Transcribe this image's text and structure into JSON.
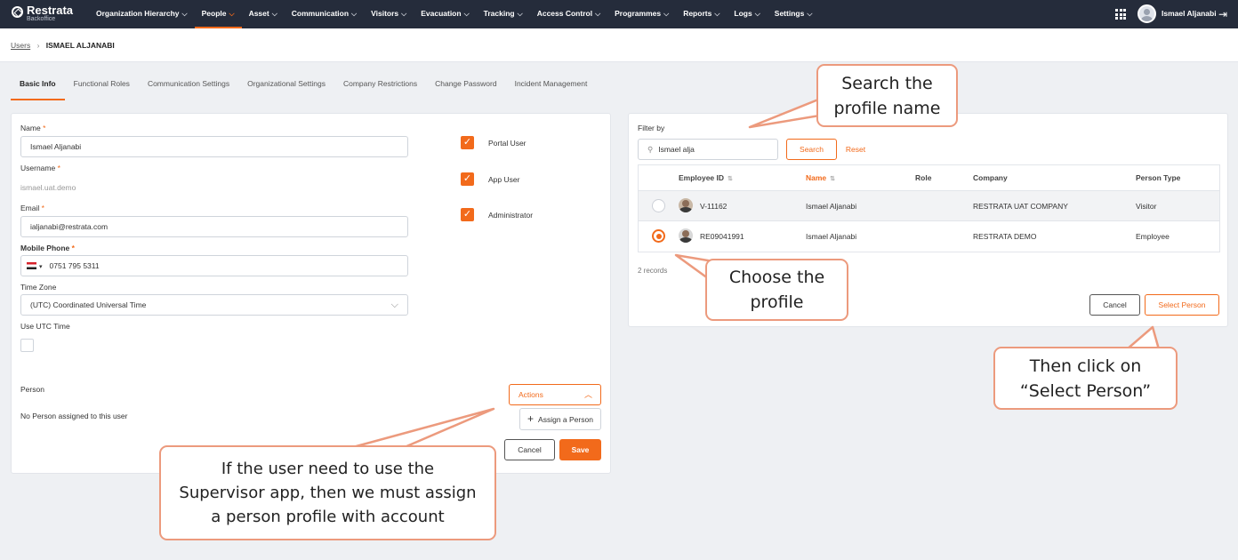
{
  "app": {
    "name": "Restrata",
    "sub": "Backoffice"
  },
  "nav": [
    {
      "label": "Organization Hierarchy",
      "active": false
    },
    {
      "label": "People",
      "active": true
    },
    {
      "label": "Asset",
      "active": false
    },
    {
      "label": "Communication",
      "active": false
    },
    {
      "label": "Visitors",
      "active": false
    },
    {
      "label": "Evacuation",
      "active": false
    },
    {
      "label": "Tracking",
      "active": false
    },
    {
      "label": "Access Control",
      "active": false
    },
    {
      "label": "Programmes",
      "active": false
    },
    {
      "label": "Reports",
      "active": false
    },
    {
      "label": "Logs",
      "active": false
    },
    {
      "label": "Settings",
      "active": false
    }
  ],
  "user": {
    "name": "Ismael Aljanabi"
  },
  "breadcrumb": {
    "parent": "Users",
    "separator": "›",
    "current": "ISMAEL ALJANABI"
  },
  "tabs": [
    "Basic Info",
    "Functional Roles",
    "Communication Settings",
    "Organizational Settings",
    "Company Restrictions",
    "Change Password",
    "Incident Management"
  ],
  "form": {
    "name_label": "Name",
    "name_value": "Ismael Aljanabi",
    "username_label": "Username",
    "username_value": "ismael.uat.demo",
    "email_label": "Email",
    "email_value": "ialjanabi@restrata.com",
    "mobile_label": "Mobile Phone",
    "mobile_value": "0751 795 5311",
    "timezone_label": "Time Zone",
    "timezone_value": "(UTC) Coordinated Universal Time",
    "utc_label": "Use UTC Time",
    "required_mark": "*"
  },
  "roles": [
    {
      "label": "Portal User",
      "checked": true
    },
    {
      "label": "App User",
      "checked": true
    },
    {
      "label": "Administrator",
      "checked": true
    }
  ],
  "person": {
    "title": "Person",
    "empty_text": "No Person assigned to this user",
    "actions_label": "Actions",
    "assign_label": "Assign a Person",
    "cancel_label": "Cancel",
    "save_label": "Save"
  },
  "picker": {
    "filter_label": "Filter by",
    "search_value": "Ismael alja",
    "search_button": "Search",
    "reset_button": "Reset",
    "columns": [
      "Employee ID",
      "Name",
      "Role",
      "Company",
      "Person Type"
    ],
    "rows": [
      {
        "id": "V-11162",
        "name": "Ismael Aljanabi",
        "role": "",
        "company": "RESTRATA UAT COMPANY",
        "type": "Visitor",
        "selected": false
      },
      {
        "id": "RE09041991",
        "name": "Ismael Aljanabi",
        "role": "",
        "company": "RESTRATA DEMO",
        "type": "Employee",
        "selected": true
      }
    ],
    "records": "2 records",
    "cancel_label": "Cancel",
    "select_label": "Select Person"
  },
  "callouts": {
    "search": [
      "Search the",
      "profile name"
    ],
    "choose": [
      "Choose the",
      "profile"
    ],
    "select": [
      "Then click on",
      "“Select Person”"
    ],
    "assign": [
      "If the user need to use the",
      "Supervisor app, then we must assign",
      "a person profile with account"
    ]
  },
  "colors": {
    "accent": "#f26a1b",
    "nav_bg": "#252c3b",
    "callout_border": "#ec9a7d"
  },
  "icons": {
    "search": "search-icon",
    "caret": "chevron-down-icon",
    "plus": "plus-icon",
    "apps": "grid-icon",
    "logout": "logout-icon"
  }
}
